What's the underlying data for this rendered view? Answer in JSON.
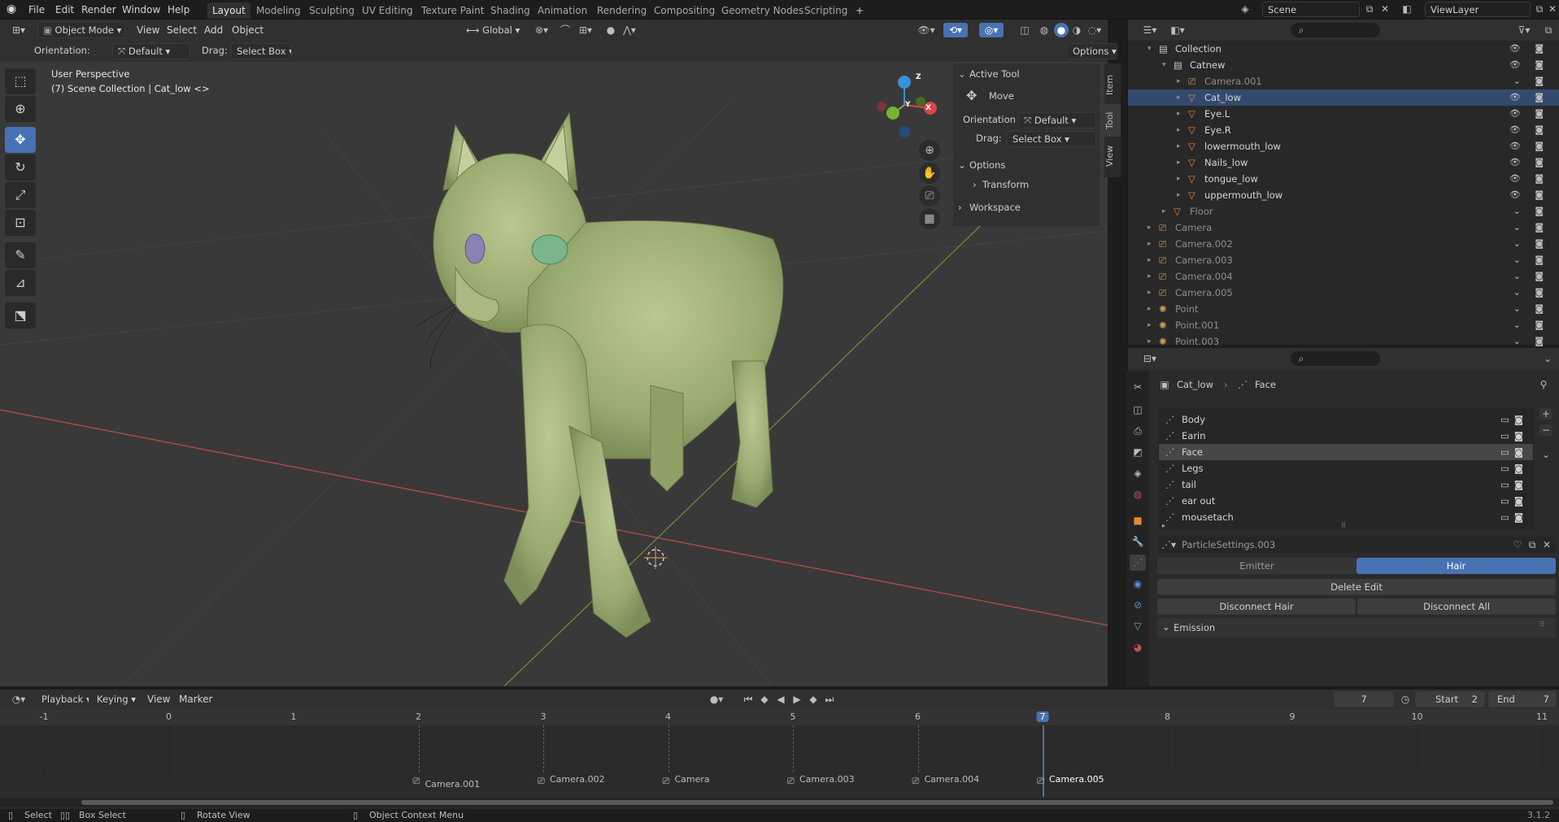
{
  "topbar": {
    "menus": [
      "File",
      "Edit",
      "Render",
      "Window",
      "Help"
    ],
    "workspaces": [
      "Layout",
      "Modeling",
      "Sculpting",
      "UV Editing",
      "Texture Paint",
      "Shading",
      "Animation",
      "Rendering",
      "Compositing",
      "Geometry Nodes",
      "Scripting"
    ],
    "active_workspace": "Layout",
    "add_tab": "+",
    "scene_label": "Scene",
    "viewlayer_label": "ViewLayer"
  },
  "viewport": {
    "mode": "Object Mode",
    "menus": [
      "View",
      "Select",
      "Add",
      "Object"
    ],
    "transform_orientation": "Global",
    "options_label": "Options",
    "orientation_label": "Orientation:",
    "orientation_value": "Default",
    "drag_label": "Drag:",
    "drag_value": "Select Box",
    "info_line1": "User Perspective",
    "info_line2": "(7) Scene Collection | Cat_low <>",
    "gizmo": {
      "z": "Z",
      "y": "Y",
      "x": "X"
    },
    "tools": [
      "select-box",
      "cursor",
      "move",
      "rotate",
      "scale",
      "transform",
      "annotate",
      "measure",
      "add-cube"
    ],
    "active_tool": "move"
  },
  "npanel": {
    "section_active_tool": "Active Tool",
    "tool_name": "Move",
    "orientation_label": "Orientation",
    "orientation_value": "Default",
    "drag_label": "Drag:",
    "drag_value": "Select Box",
    "section_options": "Options",
    "transform_label": "Transform",
    "section_workspace": "Workspace",
    "tabs": [
      "Item",
      "Tool",
      "View"
    ]
  },
  "outliner": {
    "search_placeholder": "",
    "rows": [
      {
        "name": "Collection",
        "indent": 1,
        "type": "collection",
        "dim": false
      },
      {
        "name": "Catnew",
        "indent": 2,
        "type": "collection",
        "dim": false
      },
      {
        "name": "Camera.001",
        "indent": 3,
        "type": "camera",
        "dim": true
      },
      {
        "name": "Cat_low",
        "indent": 3,
        "type": "mesh",
        "dim": false
      },
      {
        "name": "Eye.L",
        "indent": 3,
        "type": "mesh",
        "dim": false
      },
      {
        "name": "Eye.R",
        "indent": 3,
        "type": "mesh",
        "dim": false
      },
      {
        "name": "lowermouth_low",
        "indent": 3,
        "type": "mesh",
        "dim": false
      },
      {
        "name": "Nails_low",
        "indent": 3,
        "type": "mesh",
        "dim": false
      },
      {
        "name": "tongue_low",
        "indent": 3,
        "type": "mesh",
        "dim": false
      },
      {
        "name": "uppermouth_low",
        "indent": 3,
        "type": "mesh",
        "dim": false
      },
      {
        "name": "Floor",
        "indent": 2,
        "type": "mesh",
        "dim": true
      },
      {
        "name": "Camera",
        "indent": 1,
        "type": "camera",
        "dim": true
      },
      {
        "name": "Camera.002",
        "indent": 1,
        "type": "camera",
        "dim": true
      },
      {
        "name": "Camera.003",
        "indent": 1,
        "type": "camera",
        "dim": true
      },
      {
        "name": "Camera.004",
        "indent": 1,
        "type": "camera",
        "dim": true
      },
      {
        "name": "Camera.005",
        "indent": 1,
        "type": "camera",
        "dim": true
      },
      {
        "name": "Point",
        "indent": 1,
        "type": "light",
        "dim": true
      },
      {
        "name": "Point.001",
        "indent": 1,
        "type": "light",
        "dim": true
      },
      {
        "name": "Point.003",
        "indent": 1,
        "type": "light",
        "dim": true
      }
    ]
  },
  "properties": {
    "breadcrumb_object": "Cat_low",
    "breadcrumb_data": "Face",
    "particle_systems": [
      "Body",
      "Earin",
      "Face",
      "Legs",
      "tail",
      "ear out",
      "mousetach"
    ],
    "selected_system": "Face",
    "settings_name": "ParticleSettings.003",
    "emitter_label": "Emitter",
    "hair_label": "Hair",
    "delete_edit_label": "Delete Edit",
    "disconnect_hair_label": "Disconnect Hair",
    "disconnect_all_label": "Disconnect All",
    "emission_label": "Emission"
  },
  "timeline": {
    "menus": [
      "Playback",
      "Keying",
      "View",
      "Marker"
    ],
    "current_frame": "7",
    "start_label": "Start",
    "start_value": "2",
    "end_label": "End",
    "end_value": "7",
    "ruler": [
      "-1",
      "0",
      "1",
      "2",
      "3",
      "4",
      "5",
      "6",
      "7",
      "8",
      "9",
      "10",
      "11"
    ],
    "markers": [
      {
        "frame": 2,
        "label": "Camera.001"
      },
      {
        "frame": 3,
        "label": "Camera.002"
      },
      {
        "frame": 4,
        "label": "Camera"
      },
      {
        "frame": 5,
        "label": "Camera.003"
      },
      {
        "frame": 6,
        "label": "Camera.004"
      },
      {
        "frame": 7,
        "label": "Camera.005"
      }
    ]
  },
  "statusbar": {
    "select": "Select",
    "box_select": "Box Select",
    "rotate_view": "Rotate View",
    "context_menu": "Object Context Menu",
    "version": "3.1.2"
  },
  "colors": {
    "accent": "#4772b3",
    "viewport_bg": "#393939",
    "cat_fur": "#a9b981",
    "x_axis": "#b84b4b",
    "y_axis": "#6f8a3a"
  }
}
